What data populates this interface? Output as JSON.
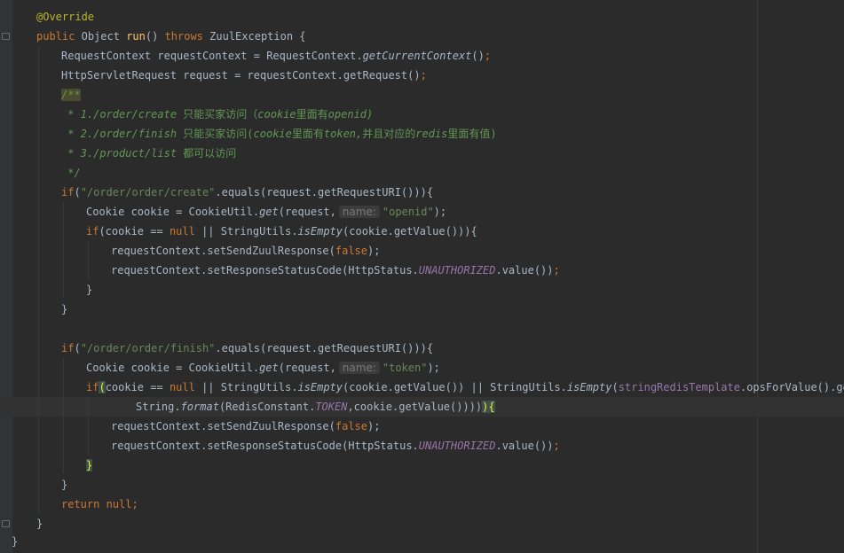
{
  "editor": {
    "lines": {
      "l1": [
        "@Override"
      ],
      "l2": [
        "public",
        "Object",
        "run",
        "()",
        "throws",
        "ZuulException {"
      ],
      "l3": [
        "RequestContext requestContext = RequestContext.",
        "getCurrentContext",
        "()",
        ";"
      ],
      "l4": [
        "HttpServletRequest request = requestContext.getRequest()",
        ";"
      ],
      "l5": [
        "/**"
      ],
      "l6": [
        " * 1./order/create ",
        "只能买家访问（",
        "cookie",
        "里面有",
        "openid)"
      ],
      "l7": [
        " * 2./order/finish ",
        "只能买家访问(",
        "cookie",
        "里面有",
        "token,",
        "并且对应的",
        "redis",
        "里面有值)"
      ],
      "l8": [
        " * 3./product/list ",
        "都可以访问"
      ],
      "l9": [
        " */"
      ],
      "l10": [
        "if",
        "(",
        "\"/order/order/create\"",
        ".equals(request.getRequestURI())){"
      ],
      "l11": [
        "Cookie cookie = CookieUtil.",
        "get",
        "(request,",
        "name:",
        "\"openid\"",
        ");"
      ],
      "l12": [
        "if",
        "(cookie == ",
        "null",
        " || StringUtils.",
        "isEmpty",
        "(cookie.getValue())){"
      ],
      "l13": [
        "requestContext.setSendZuulResponse(",
        "false",
        ");"
      ],
      "l14": [
        "requestContext.setResponseStatusCode(HttpStatus.",
        "UNAUTHORIZED",
        ".value())",
        ";"
      ],
      "l15": [
        "}"
      ],
      "l16": [
        "}"
      ],
      "l17": [
        "if",
        "(",
        "\"/order/order/finish\"",
        ".equals(request.getRequestURI())){"
      ],
      "l18": [
        "Cookie cookie = CookieUtil.",
        "get",
        "(request,",
        "name:",
        "\"token\"",
        ");"
      ],
      "l19": [
        "if",
        "(",
        "cookie == ",
        "null",
        " || StringUtils.",
        "isEmpty",
        "(cookie.getValue()) || StringUtils.",
        "isEmpty",
        "(",
        "stringRedisTemplate",
        ".opsForValue().get("
      ],
      "l20": [
        "String.",
        "format",
        "(RedisConstant.",
        "TOKEN",
        ",cookie.getValue())))",
        ")",
        "{"
      ],
      "l21": [
        "requestContext.setSendZuulResponse(",
        "false",
        ");"
      ],
      "l22": [
        "requestContext.setResponseStatusCode(HttpStatus.",
        "UNAUTHORIZED",
        ".value())",
        ";"
      ],
      "l23": [
        "}"
      ],
      "l24": [
        "}"
      ],
      "l25": [
        "return",
        "null",
        ";"
      ],
      "l26": [
        "}"
      ],
      "l27": [
        "}"
      ]
    }
  }
}
